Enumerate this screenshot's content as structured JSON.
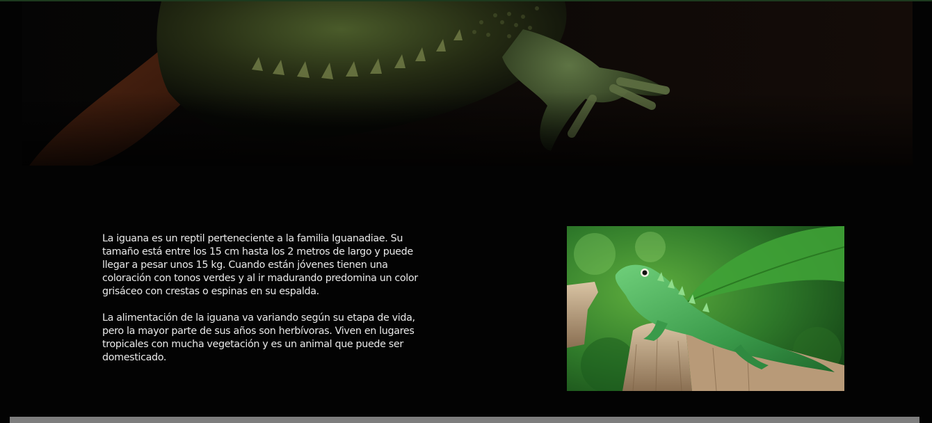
{
  "hero": {
    "image": "iguana-closeup-dark-banner"
  },
  "article": {
    "paragraphs": [
      "La iguana es un reptil perteneciente a la familia Iguanadiae. Su tamaño está entre los 15 cm hasta los 2 metros de largo y puede llegar a pesar unos 15 kg. Cuando están jóvenes tienen una coloración con tonos verdes y al ir madurando predomina un color grisáceo con crestas o espinas en su espalda.",
      "La alimentación de la iguana va variando según su etapa de vida, pero la mayor parte de sus años son herbívoras. Viven en lugares tropicales con mucha vegetación y es un animal que puede ser domesticado."
    ]
  },
  "photo": {
    "image": "green-iguana-on-tree-stump"
  },
  "colors": {
    "background": "#030303",
    "text": "#e9e9e9",
    "bottom_bar": "#7e7e7e"
  }
}
